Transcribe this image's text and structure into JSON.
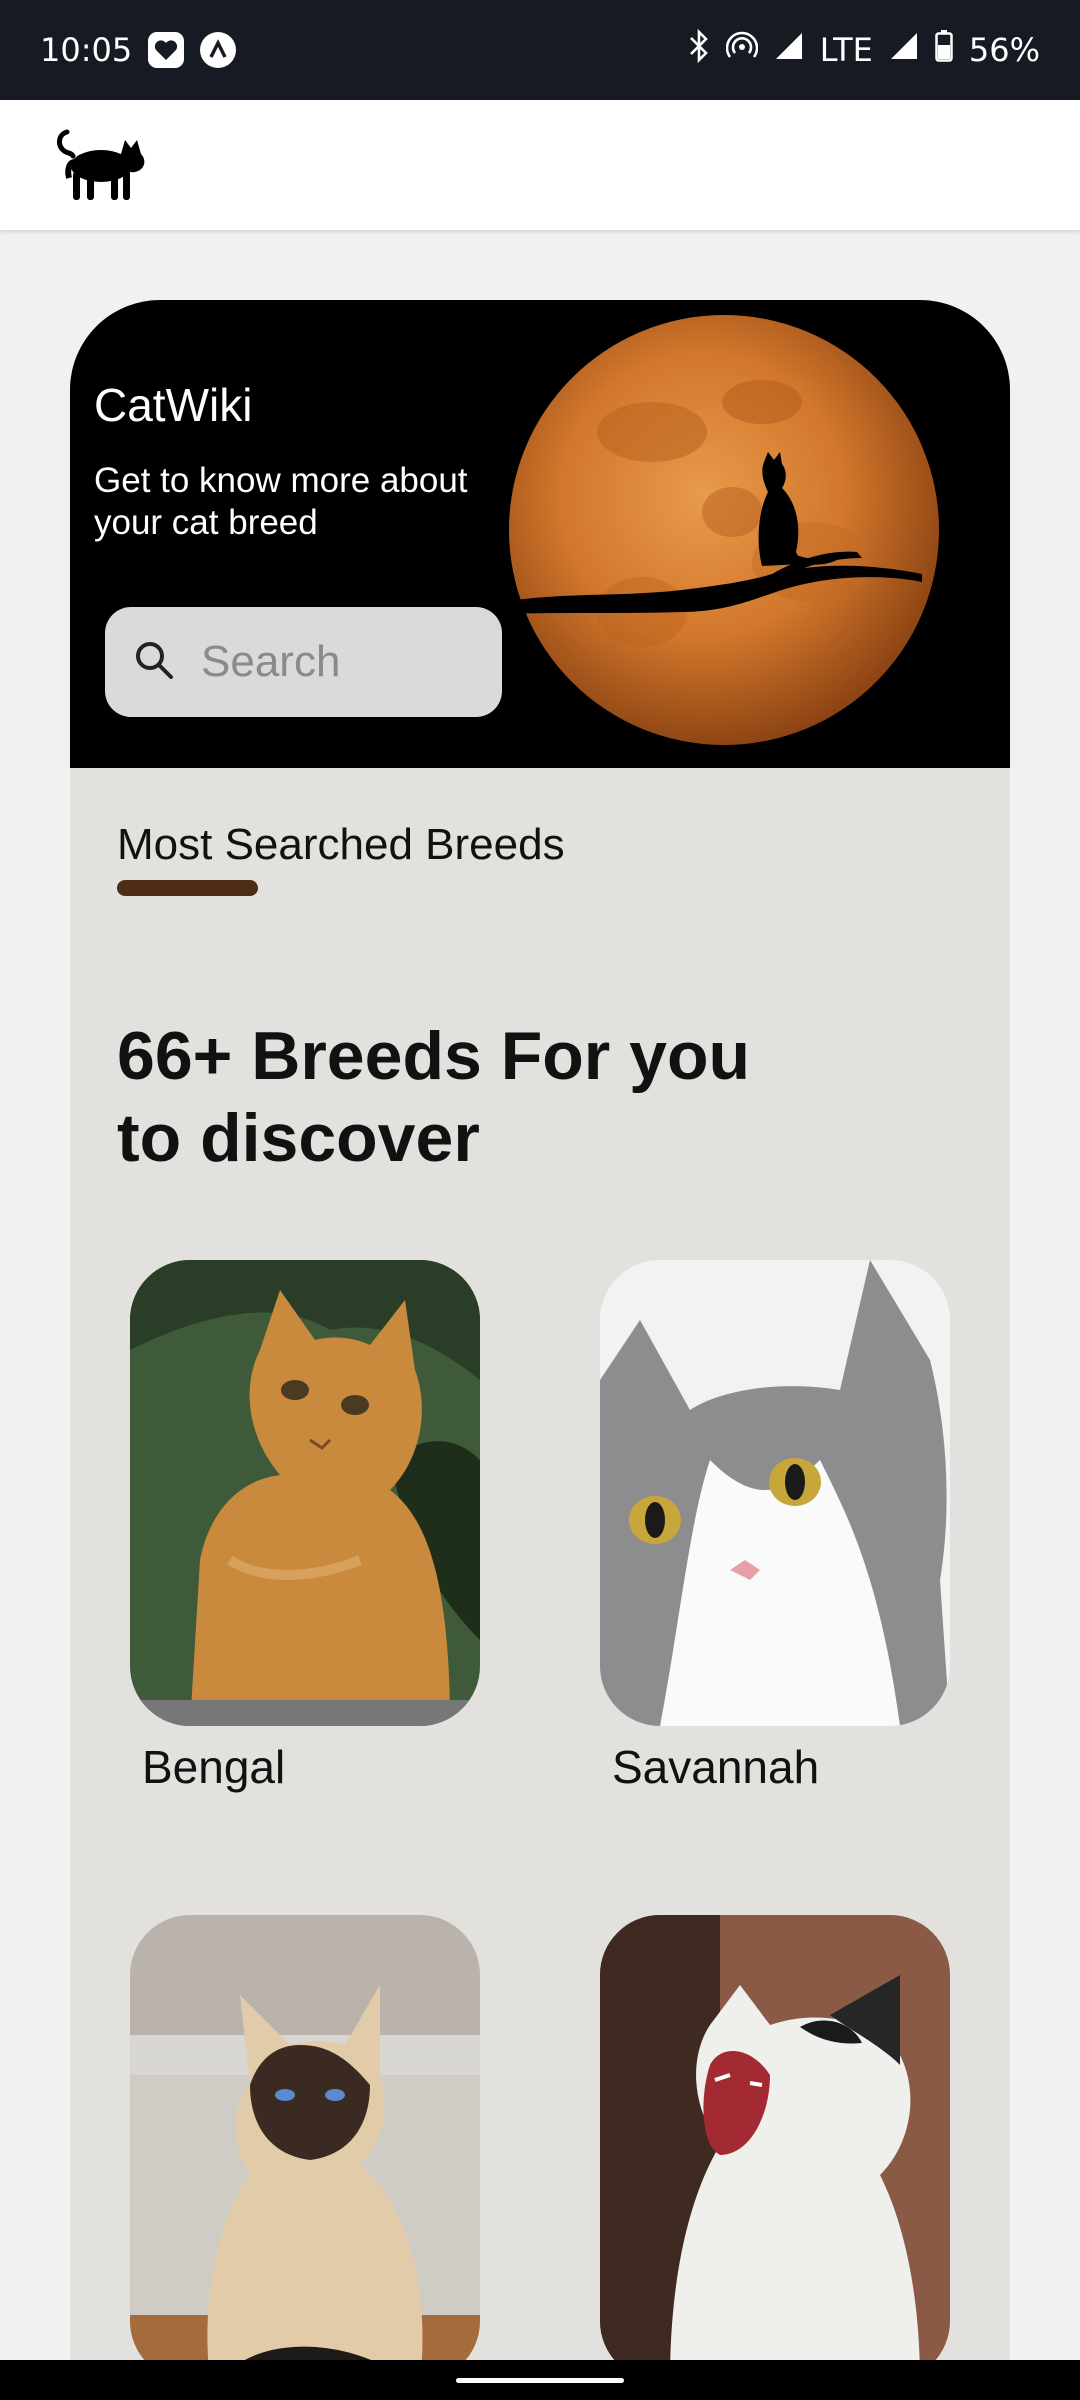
{
  "status_bar": {
    "time": "10:05",
    "network": "LTE",
    "battery": "56%",
    "icons": [
      "heart-notification-icon",
      "arch-notification-icon",
      "bluetooth-icon",
      "hotspot-icon",
      "signal-icon",
      "battery-icon"
    ]
  },
  "app_bar": {
    "logo": "cat-silhouette-logo"
  },
  "hero": {
    "title": "CatWiki",
    "subtitle": "Get to know more about\n your cat breed",
    "search_placeholder": "Search",
    "image": "orange-moon-cat-silhouette"
  },
  "section": {
    "title": "Most Searched Breeds",
    "accent_color": "#4e2d16"
  },
  "headline": "66+ Breeds For you\n to discover",
  "breeds": [
    {
      "name": "Bengal",
      "image": "orange-tabby-kitten"
    },
    {
      "name": "Savannah",
      "image": "grey-white-cat"
    },
    {
      "name": "",
      "image": "siamese-cat"
    },
    {
      "name": "",
      "image": "yawning-black-white-cat"
    }
  ],
  "colors": {
    "hero_bg": "#000000",
    "card_bg": "#e3e1dd",
    "page_bg": "#f1f1f1",
    "status_bar": "#161a22"
  }
}
